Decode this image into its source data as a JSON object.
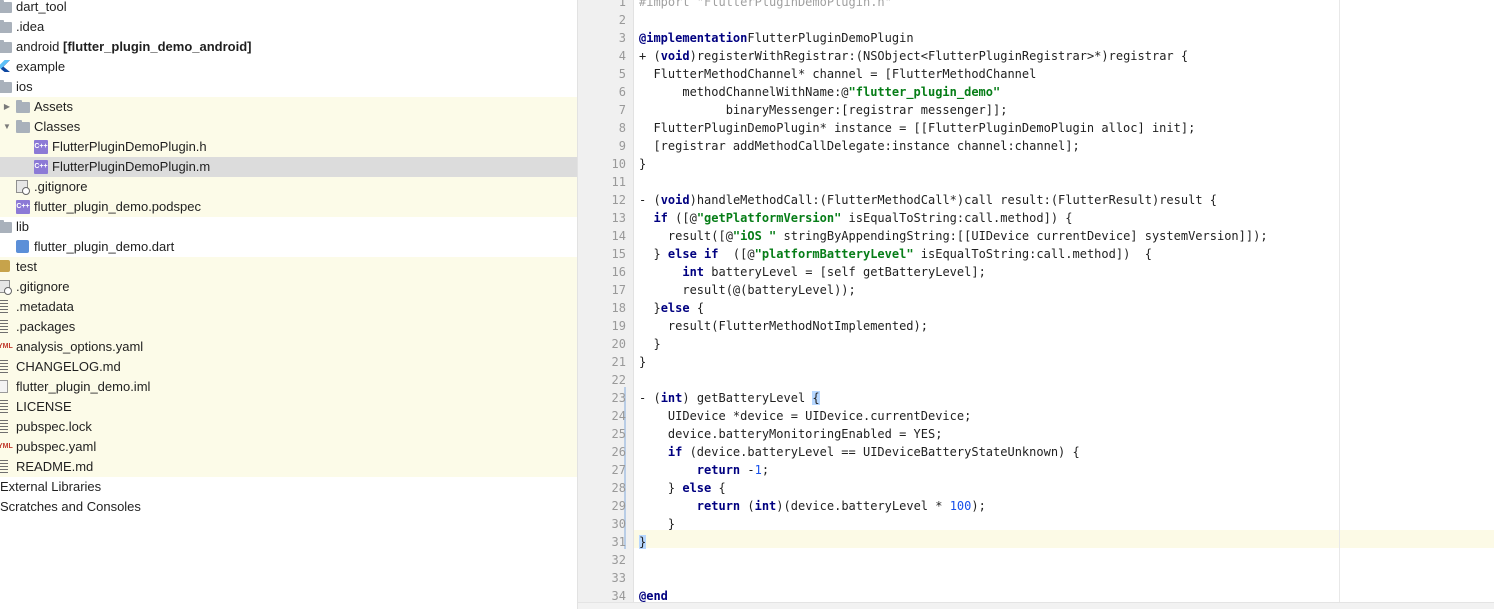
{
  "tree": [
    {
      "label": "dart_tool",
      "bold": "",
      "depth": 0,
      "arrow": "",
      "icon": "folder",
      "hl": "none",
      "icon_name": "folder-icon"
    },
    {
      "label": ".idea",
      "bold": "",
      "depth": 0,
      "arrow": "",
      "icon": "folder",
      "hl": "none",
      "icon_name": "folder-icon"
    },
    {
      "label": "android ",
      "bold": "[flutter_plugin_demo_android]",
      "depth": 0,
      "arrow": "",
      "icon": "folder",
      "hl": "none",
      "icon_name": "folder-icon"
    },
    {
      "label": "example",
      "bold": "",
      "depth": 0,
      "arrow": "",
      "icon": "flutter",
      "hl": "none",
      "icon_name": "flutter-icon"
    },
    {
      "label": "ios",
      "bold": "",
      "depth": 0,
      "arrow": "",
      "icon": "folder",
      "hl": "none",
      "icon_name": "folder-icon"
    },
    {
      "label": "Assets",
      "bold": "",
      "depth": 1,
      "arrow": "▶",
      "icon": "folder",
      "hl": "yellow",
      "icon_name": "folder-icon"
    },
    {
      "label": "Classes",
      "bold": "",
      "depth": 1,
      "arrow": "▼",
      "icon": "folder",
      "hl": "yellow",
      "icon_name": "folder-icon"
    },
    {
      "label": "FlutterPluginDemoPlugin.h",
      "bold": "",
      "depth": 2,
      "arrow": "",
      "icon": "ch",
      "hl": "yellow",
      "icon_name": "objc-header-icon"
    },
    {
      "label": "FlutterPluginDemoPlugin.m",
      "bold": "",
      "depth": 2,
      "arrow": "",
      "icon": "ch",
      "hl": "selected",
      "icon_name": "objc-source-icon"
    },
    {
      "label": ".gitignore",
      "bold": "",
      "depth": 1,
      "arrow": "",
      "icon": "git",
      "hl": "yellow",
      "icon_name": "gitignore-icon"
    },
    {
      "label": "flutter_plugin_demo.podspec",
      "bold": "",
      "depth": 1,
      "arrow": "",
      "icon": "ch",
      "hl": "yellow",
      "icon_name": "podspec-icon"
    },
    {
      "label": "lib",
      "bold": "",
      "depth": 0,
      "arrow": "",
      "icon": "folder",
      "hl": "none",
      "icon_name": "folder-icon"
    },
    {
      "label": "flutter_plugin_demo.dart",
      "bold": "",
      "depth": 1,
      "arrow": "",
      "icon": "dart",
      "hl": "none",
      "icon_name": "dart-file-icon"
    },
    {
      "label": "test",
      "bold": "",
      "depth": 0,
      "arrow": "",
      "icon": "test",
      "hl": "yellow",
      "icon_name": "test-folder-icon"
    },
    {
      "label": ".gitignore",
      "bold": "",
      "depth": 0,
      "arrow": "",
      "icon": "git",
      "hl": "yellow",
      "icon_name": "gitignore-icon"
    },
    {
      "label": ".metadata",
      "bold": "",
      "depth": 0,
      "arrow": "",
      "icon": "lines",
      "hl": "yellow",
      "icon_name": "text-file-icon"
    },
    {
      "label": ".packages",
      "bold": "",
      "depth": 0,
      "arrow": "",
      "icon": "lines",
      "hl": "yellow",
      "icon_name": "text-file-icon"
    },
    {
      "label": "analysis_options.yaml",
      "bold": "",
      "depth": 0,
      "arrow": "",
      "icon": "yml",
      "hl": "yellow",
      "icon_name": "yaml-file-icon"
    },
    {
      "label": "CHANGELOG.md",
      "bold": "",
      "depth": 0,
      "arrow": "",
      "icon": "lines",
      "hl": "yellow",
      "icon_name": "markdown-file-icon"
    },
    {
      "label": "flutter_plugin_demo.iml",
      "bold": "",
      "depth": 0,
      "arrow": "",
      "icon": "file",
      "hl": "yellow",
      "icon_name": "iml-file-icon"
    },
    {
      "label": "LICENSE",
      "bold": "",
      "depth": 0,
      "arrow": "",
      "icon": "lines",
      "hl": "yellow",
      "icon_name": "text-file-icon"
    },
    {
      "label": "pubspec.lock",
      "bold": "",
      "depth": 0,
      "arrow": "",
      "icon": "lines",
      "hl": "yellow",
      "icon_name": "text-file-icon"
    },
    {
      "label": "pubspec.yaml",
      "bold": "",
      "depth": 0,
      "arrow": "",
      "icon": "yml",
      "hl": "yellow",
      "icon_name": "yaml-file-icon"
    },
    {
      "label": "README.md",
      "bold": "",
      "depth": 0,
      "arrow": "",
      "icon": "lines",
      "hl": "yellow",
      "icon_name": "markdown-file-icon"
    },
    {
      "label": "External Libraries",
      "bold": "",
      "depth": -1,
      "arrow": "",
      "icon": "",
      "hl": "none",
      "icon_name": ""
    },
    {
      "label": "Scratches and Consoles",
      "bold": "",
      "depth": -1,
      "arrow": "",
      "icon": "",
      "hl": "none",
      "icon_name": ""
    }
  ],
  "editor": {
    "colors": {
      "keyword": "#000080",
      "string": "#067d17",
      "number": "#1750eb",
      "caret_line": "#fcfae6"
    },
    "lines": [
      {
        "no": "1",
        "segs": [
          [
            "c",
            "#import \"FlutterPluginDemoPlugin.h\""
          ]
        ]
      },
      {
        "no": "2",
        "segs": []
      },
      {
        "no": "3",
        "segs": [
          [
            "k",
            "@implementation"
          ],
          [
            "",
            "FlutterPluginDemoPlugin"
          ]
        ]
      },
      {
        "no": "4",
        "segs": [
          [
            "",
            "+ ("
          ],
          [
            "k",
            "void"
          ],
          [
            "",
            ")registerWithRegistrar:(NSObject<FlutterPluginRegistrar>*)registrar {"
          ]
        ]
      },
      {
        "no": "5",
        "segs": [
          [
            "",
            "  FlutterMethodChannel* channel = [FlutterMethodChannel"
          ]
        ]
      },
      {
        "no": "6",
        "segs": [
          [
            "",
            "      methodChannelWithName:@"
          ],
          [
            "s",
            "\"flutter_plugin_demo\""
          ]
        ]
      },
      {
        "no": "7",
        "segs": [
          [
            "",
            "            binaryMessenger:[registrar messenger]];"
          ]
        ]
      },
      {
        "no": "8",
        "segs": [
          [
            "",
            "  FlutterPluginDemoPlugin* instance = [[FlutterPluginDemoPlugin alloc] init];"
          ]
        ]
      },
      {
        "no": "9",
        "segs": [
          [
            "",
            "  [registrar addMethodCallDelegate:instance channel:channel];"
          ]
        ]
      },
      {
        "no": "10",
        "segs": [
          [
            "",
            "}"
          ]
        ]
      },
      {
        "no": "11",
        "segs": []
      },
      {
        "no": "12",
        "segs": [
          [
            "",
            "- ("
          ],
          [
            "k",
            "void"
          ],
          [
            "",
            ")handleMethodCall:(FlutterMethodCall*)call result:(FlutterResult)result {"
          ]
        ]
      },
      {
        "no": "13",
        "segs": [
          [
            "",
            "  "
          ],
          [
            "k",
            "if"
          ],
          [
            "",
            " ([@"
          ],
          [
            "s",
            "\"getPlatformVersion\""
          ],
          [
            "",
            " isEqualToString:call.method]) {"
          ]
        ]
      },
      {
        "no": "14",
        "segs": [
          [
            "",
            "    result([@"
          ],
          [
            "s",
            "\"iOS \""
          ],
          [
            "",
            " stringByAppendingString:[[UIDevice currentDevice] systemVersion]]);"
          ]
        ]
      },
      {
        "no": "15",
        "segs": [
          [
            "",
            "  } "
          ],
          [
            "k",
            "else if"
          ],
          [
            "",
            "  ([@"
          ],
          [
            "s",
            "\"platformBatteryLevel\""
          ],
          [
            "",
            " isEqualToString:call.method])  {"
          ]
        ]
      },
      {
        "no": "16",
        "segs": [
          [
            "",
            "      "
          ],
          [
            "k",
            "int"
          ],
          [
            "",
            " batteryLevel = [self getBatteryLevel];"
          ]
        ]
      },
      {
        "no": "17",
        "segs": [
          [
            "",
            "      result(@(batteryLevel));"
          ]
        ]
      },
      {
        "no": "18",
        "segs": [
          [
            "",
            "  }"
          ],
          [
            "k",
            "else"
          ],
          [
            "",
            " {"
          ]
        ]
      },
      {
        "no": "19",
        "segs": [
          [
            "",
            "    result(FlutterMethodNotImplemented);"
          ]
        ]
      },
      {
        "no": "20",
        "segs": [
          [
            "",
            "  }"
          ]
        ]
      },
      {
        "no": "21",
        "segs": [
          [
            "",
            "}"
          ]
        ]
      },
      {
        "no": "22",
        "segs": []
      },
      {
        "no": "23",
        "segs": [
          [
            "",
            "- ("
          ],
          [
            "k",
            "int"
          ],
          [
            "",
            ") getBatteryLevel "
          ],
          [
            "br",
            "{"
          ]
        ]
      },
      {
        "no": "24",
        "segs": [
          [
            "",
            "    UIDevice *device = UIDevice.currentDevice;"
          ]
        ]
      },
      {
        "no": "25",
        "segs": [
          [
            "",
            "    device.batteryMonitoringEnabled = YES;"
          ]
        ]
      },
      {
        "no": "26",
        "segs": [
          [
            "",
            "    "
          ],
          [
            "k",
            "if"
          ],
          [
            "",
            " (device.batteryLevel == UIDeviceBatteryStateUnknown) {"
          ]
        ]
      },
      {
        "no": "27",
        "segs": [
          [
            "",
            "        "
          ],
          [
            "k",
            "return"
          ],
          [
            "",
            " -"
          ],
          [
            "n",
            "1"
          ],
          [
            "",
            ";"
          ]
        ]
      },
      {
        "no": "28",
        "segs": [
          [
            "",
            "    } "
          ],
          [
            "k",
            "else"
          ],
          [
            "",
            " {"
          ]
        ]
      },
      {
        "no": "29",
        "segs": [
          [
            "",
            "        "
          ],
          [
            "k",
            "return"
          ],
          [
            "",
            " ("
          ],
          [
            "k",
            "int"
          ],
          [
            "",
            ")(device.batteryLevel * "
          ],
          [
            "n",
            "100"
          ],
          [
            "",
            ");"
          ]
        ]
      },
      {
        "no": "30",
        "segs": [
          [
            "",
            "    }"
          ]
        ]
      },
      {
        "no": "31",
        "segs": [
          [
            "br",
            "}"
          ]
        ]
      },
      {
        "no": "32",
        "segs": []
      },
      {
        "no": "33",
        "segs": []
      },
      {
        "no": "34",
        "segs": [
          [
            "k",
            "@end"
          ]
        ]
      }
    ]
  }
}
